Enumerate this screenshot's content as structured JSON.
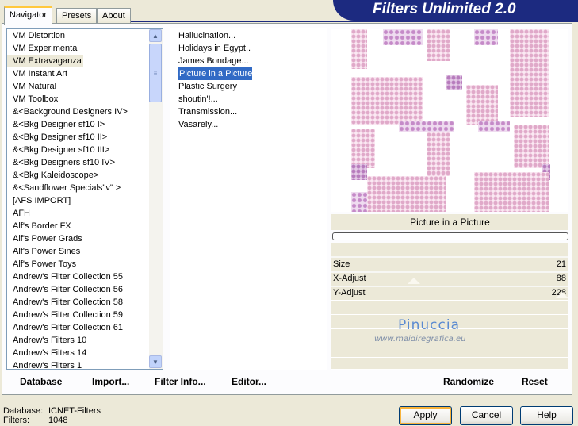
{
  "tabs": {
    "navigator": "Navigator",
    "presets": "Presets",
    "about": "About"
  },
  "banner_title": "Filters Unlimited 2.0",
  "categories": [
    "VM Distortion",
    "VM Experimental",
    "VM Extravaganza",
    "VM Instant Art",
    "VM Natural",
    "VM Toolbox",
    "&<Background Designers IV>",
    "&<Bkg Designer sf10 I>",
    "&<Bkg Designer sf10 II>",
    "&<Bkg Designer sf10 III>",
    "&<Bkg Designers sf10 IV>",
    "&<Bkg Kaleidoscope>",
    "&<Sandflower Specials\"v\" >",
    "[AFS IMPORT]",
    "AFH",
    "Alf's Border FX",
    "Alf's Power Grads",
    "Alf's Power Sines",
    "Alf's Power Toys",
    "Andrew's Filter Collection 55",
    "Andrew's Filter Collection 56",
    "Andrew's Filter Collection 58",
    "Andrew's Filter Collection 59",
    "Andrew's Filter Collection 61",
    "Andrew's Filters 10",
    "Andrew's Filters 14",
    "Andrew's Filters 1"
  ],
  "filters": [
    "Hallucination...",
    "Holidays in Egypt..",
    "James Bondage...",
    "Picture in a Picture",
    "Plastic Surgery",
    "shoutin'!...",
    "Transmission...",
    "Vasarely..."
  ],
  "selected_filter_name": "Picture in a Picture",
  "params": [
    {
      "label": "Size",
      "value": "21"
    },
    {
      "label": "X-Adjust",
      "value": "88"
    },
    {
      "label": "Y-Adjust",
      "value": "228"
    }
  ],
  "watermark": {
    "name": "Pinuccia",
    "url": "www.maidiregrafica.eu"
  },
  "actions": {
    "database": "Database",
    "import": "Import...",
    "filter_info": "Filter Info...",
    "editor": "Editor...",
    "randomize": "Randomize",
    "reset": "Reset"
  },
  "status": {
    "database_label": "Database:",
    "database_value": "ICNET-Filters",
    "filters_label": "Filters:",
    "filters_value": "1048"
  },
  "buttons": {
    "apply": "Apply",
    "cancel": "Cancel",
    "help": "Help"
  },
  "colors": {
    "banner": "#1c2a80",
    "selection": "#316ac5",
    "preview_pattern": "#c58ac8"
  }
}
